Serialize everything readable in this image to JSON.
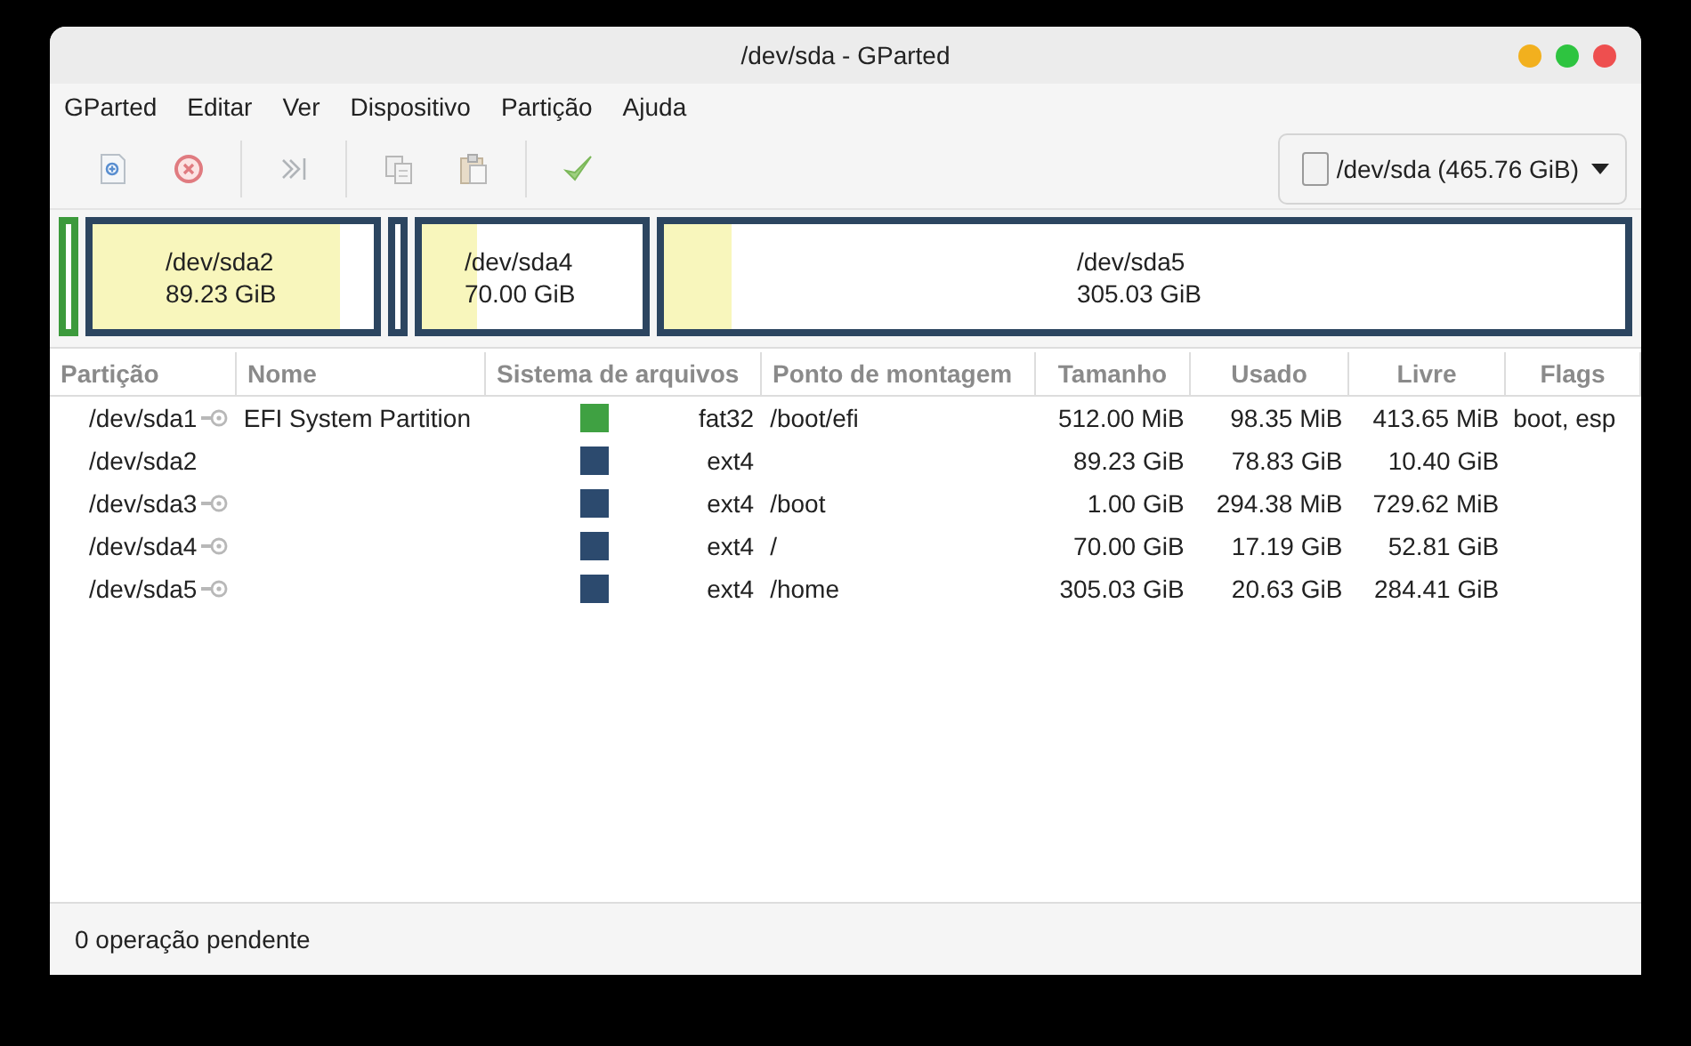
{
  "window": {
    "title": "/dev/sda - GParted"
  },
  "menu": [
    "GParted",
    "Editar",
    "Ver",
    "Dispositivo",
    "Partição",
    "Ajuda"
  ],
  "toolbar": [
    {
      "kind": "new"
    },
    {
      "kind": "delete"
    },
    {
      "kind": "sep"
    },
    {
      "kind": "resize"
    },
    {
      "kind": "sep"
    },
    {
      "kind": "copy"
    },
    {
      "kind": "paste"
    },
    {
      "kind": "sep"
    },
    {
      "kind": "apply"
    }
  ],
  "device": {
    "label": "/dev/sda (465.76 GiB)"
  },
  "disk_map": [
    {
      "kind": "small",
      "color": "#3c9a3c"
    },
    {
      "kind": "labeled",
      "name": "/dev/sda2",
      "size": "89.23 GiB",
      "level": 0.88,
      "color": "#2c4560"
    },
    {
      "kind": "small",
      "color": "#2c4560"
    },
    {
      "kind": "labeled",
      "name": "/dev/sda4",
      "size": "70.00 GiB",
      "level": 0.25,
      "color": "#2c4560"
    },
    {
      "kind": "labeled",
      "name": "/dev/sda5",
      "size": "305.03 GiB",
      "level": 0.07,
      "color": "#2c4560"
    }
  ],
  "table": {
    "columns": [
      "Partição",
      "Nome",
      "Sistema de arquivos",
      "Ponto de montagem",
      "Tamanho",
      "Usado",
      "Livre",
      "Flags"
    ],
    "rows": [
      {
        "partition": "/dev/sda1",
        "mounted": true,
        "name": "EFI System Partition",
        "color": "#3fa142",
        "filesystem": "fat32",
        "mount_point": "/boot/efi",
        "size": "512.00 MiB",
        "used": "98.35 MiB",
        "free": "413.65 MiB",
        "flags": "boot, esp"
      },
      {
        "partition": "/dev/sda2",
        "mounted": false,
        "color": "#2c4a6e",
        "filesystem": "ext4",
        "size": "89.23 GiB",
        "used": "78.83 GiB",
        "free": "10.40 GiB"
      },
      {
        "partition": "/dev/sda3",
        "mounted": true,
        "color": "#2c4a6e",
        "filesystem": "ext4",
        "mount_point": "/boot",
        "size": "1.00 GiB",
        "used": "294.38 MiB",
        "free": "729.62 MiB"
      },
      {
        "partition": "/dev/sda4",
        "mounted": true,
        "color": "#2c4a6e",
        "filesystem": "ext4",
        "mount_point": "/",
        "size": "70.00 GiB",
        "used": "17.19 GiB",
        "free": "52.81 GiB"
      },
      {
        "partition": "/dev/sda5",
        "mounted": true,
        "color": "#2c4a6e",
        "filesystem": "ext4",
        "mount_point": "/home",
        "size": "305.03 GiB",
        "used": "20.63 GiB",
        "free": "284.41 GiB"
      }
    ]
  },
  "status_bar": "0 operação pendente"
}
